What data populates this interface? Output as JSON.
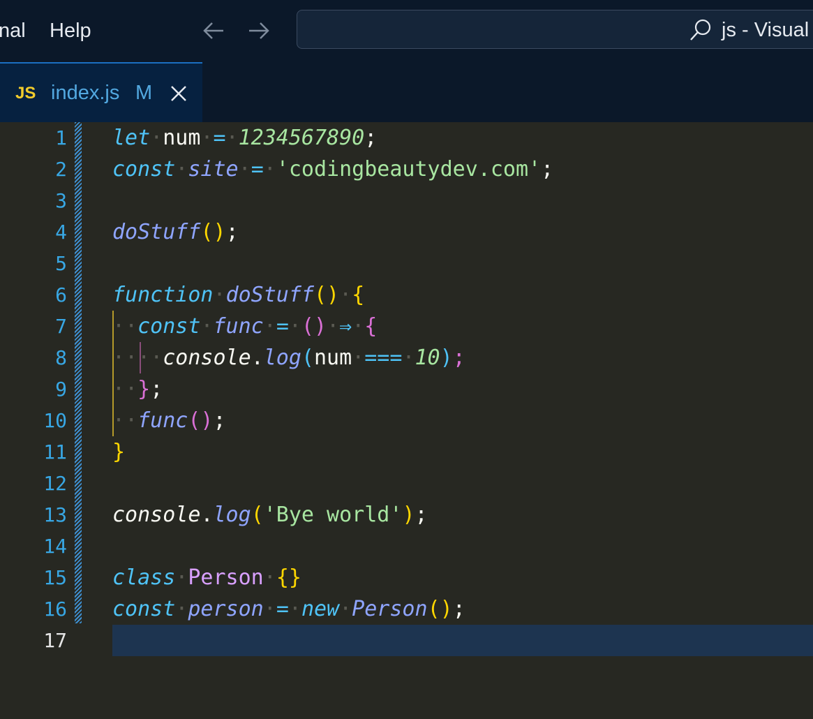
{
  "titlebar": {
    "menu_partial": "nal",
    "menu_help": "Help",
    "back_icon": "arrow-left-icon",
    "forward_icon": "arrow-right-icon",
    "search_icon": "search-icon",
    "window_title": "js - Visual"
  },
  "tab": {
    "lang_badge": "JS",
    "filename": "index.js",
    "status": "M",
    "close_icon": "close-icon"
  },
  "editor": {
    "active_line": "17",
    "lines": [
      {
        "n": "1"
      },
      {
        "n": "2"
      },
      {
        "n": "3"
      },
      {
        "n": "4"
      },
      {
        "n": "5"
      },
      {
        "n": "6"
      },
      {
        "n": "7"
      },
      {
        "n": "8"
      },
      {
        "n": "9"
      },
      {
        "n": "10"
      },
      {
        "n": "11"
      },
      {
        "n": "12"
      },
      {
        "n": "13"
      },
      {
        "n": "14"
      },
      {
        "n": "15"
      },
      {
        "n": "16"
      },
      {
        "n": "17"
      }
    ],
    "tokens": {
      "let": "let",
      "num": "num",
      "eq": "=",
      "numval": "1234567890",
      "semi": ";",
      "const": "const",
      "site": "site",
      "sitestr": "'codingbeautydev.com'",
      "doStuff": "doStuff",
      "function": "function",
      "func": "func",
      "arrow": "⇒",
      "console": "console",
      "dot": ".",
      "log": "log",
      "eqeqeq": "===",
      "ten": "10",
      "byestr": "'Bye world'",
      "class": "class",
      "Person": "Person",
      "person": "person",
      "new": "new",
      "lparen": "(",
      "rparen": ")",
      "lbrace": "{",
      "rbrace": "}",
      "emptybraces": "{}",
      "parens": "()",
      "ws": "·"
    }
  },
  "colors": {
    "titlebar_bg": "#0b1829",
    "editor_bg": "#272822",
    "keyword": "#4fc3f7",
    "function": "#8fa5ff",
    "string": "#a8e6a1",
    "bracket_1": "#ffd700",
    "bracket_2": "#da70d6",
    "class": "#d9a0ff"
  }
}
